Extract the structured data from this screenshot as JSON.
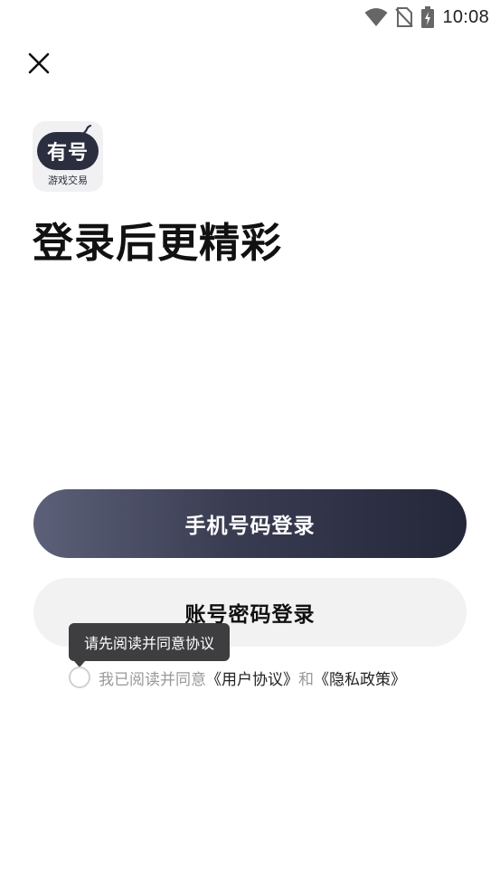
{
  "status_bar": {
    "time": "10:08",
    "icons": [
      "wifi-icon",
      "no-sim-icon",
      "battery-charging-icon"
    ]
  },
  "close_icon": "close-icon",
  "app_logo": {
    "badge_text": "有号",
    "sub_text": "游戏交易",
    "badge_color": "#2b2e3f"
  },
  "headline": "登录后更精彩",
  "buttons": {
    "phone_login": "手机号码登录",
    "account_login": "账号密码登录"
  },
  "tooltip": "请先阅读并同意协议",
  "agreement": {
    "prefix": "我已阅读并同意",
    "user_agreement": "《用户协议》",
    "conjunction": "和",
    "privacy_policy": "《隐私政策》",
    "checked": false
  },
  "colors": {
    "primary_gradient_start": "#5c6078",
    "primary_gradient_end": "#24273a",
    "secondary_button": "#f2f2f2",
    "tooltip_bg": "#3e3e40"
  }
}
